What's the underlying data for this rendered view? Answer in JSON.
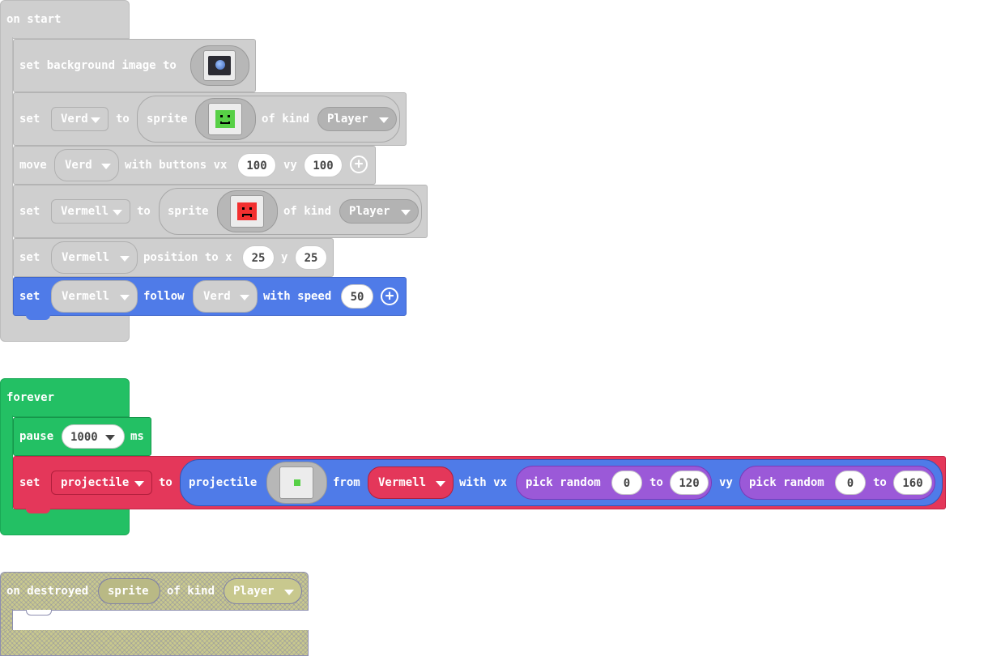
{
  "on_start": {
    "header": "on start",
    "bg_block": {
      "set": "set background image to",
      "image_icon": "earth-image-icon"
    },
    "verd_sprite": {
      "set": "set",
      "var": "Verd",
      "to": "to",
      "sprite": "sprite",
      "of_kind": "of kind",
      "kind": "Player",
      "image_icon": "green-smiley-icon"
    },
    "move": {
      "move": "move",
      "var": "Verd",
      "with_buttons_vx": "with buttons vx",
      "vx": "100",
      "vy_label": "vy",
      "vy": "100"
    },
    "vermell_sprite": {
      "set": "set",
      "var": "Vermell",
      "to": "to",
      "sprite": "sprite",
      "of_kind": "of kind",
      "kind": "Player",
      "image_icon": "red-frown-icon"
    },
    "position": {
      "set": "set",
      "var": "Vermell",
      "position_to_x": "position to x",
      "x": "25",
      "y_label": "y",
      "y": "25"
    },
    "follow": {
      "set": "set",
      "var": "Vermell",
      "follow": "follow",
      "target": "Verd",
      "with_speed": "with speed",
      "speed": "50"
    }
  },
  "forever": {
    "header": "forever",
    "pause": {
      "pause": "pause",
      "ms_value": "1000",
      "ms": "ms"
    },
    "projectile": {
      "set": "set",
      "var": "projectile",
      "to": "to",
      "projectile_label": "projectile",
      "image_icon": "green-square-icon",
      "from": "from",
      "source": "Vermell",
      "with_vx": "with vx",
      "rand1": {
        "label": "pick random",
        "min": "0",
        "to": "to",
        "max": "120"
      },
      "vy": "vy",
      "rand2": {
        "label": "pick random",
        "min": "0",
        "to": "to",
        "max": "160"
      }
    }
  },
  "on_destroyed": {
    "header": "on destroyed",
    "param": "sprite",
    "of_kind": "of kind",
    "kind": "Player"
  },
  "colors": {
    "gray": "#cfcfcf",
    "blue": "#4f7be8",
    "red": "#e4375a",
    "green": "#23c064",
    "purple": "#9b59d8",
    "olive": "#c8c88e"
  }
}
